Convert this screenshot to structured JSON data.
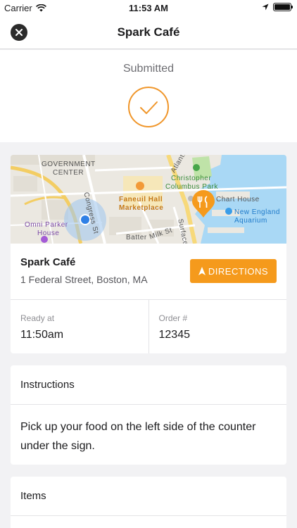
{
  "status_bar": {
    "carrier": "Carrier",
    "time": "11:53 AM"
  },
  "nav": {
    "title": "Spark Café",
    "close_icon": "close-icon"
  },
  "order_status": {
    "label": "Submitted",
    "icon": "check-circle-icon",
    "accent": "#f0962a"
  },
  "map": {
    "labels": {
      "government_center_1": "GOVERNMENT",
      "government_center_2": "CENTER",
      "congress_st": "Congress St",
      "faneuil_1": "Faneuil Hall",
      "faneuil_2": "Marketplace",
      "columbus_1": "Christopher",
      "columbus_2": "Columbus Park",
      "chart_house": "Chart House",
      "aquarium_1": "New England",
      "aquarium_2": "Aquarium",
      "omni_1": "Omni Parker",
      "omni_2": "House",
      "atlantic": "Atlantic",
      "surface": "Surface",
      "milk": "Milk St",
      "batter": "Batter"
    }
  },
  "place": {
    "name": "Spark Café",
    "address": "1 Federal Street, Boston, MA",
    "directions_label": "DIRECTIONS",
    "directions_color": "#f59a1c"
  },
  "order_info": {
    "ready_label": "Ready at",
    "ready_value": "11:50am",
    "order_label": "Order #",
    "order_value": "12345"
  },
  "instructions": {
    "heading": "Instructions",
    "body": "Pick up your food on the left side of the counter under the sign."
  },
  "items": {
    "heading": "Items"
  }
}
